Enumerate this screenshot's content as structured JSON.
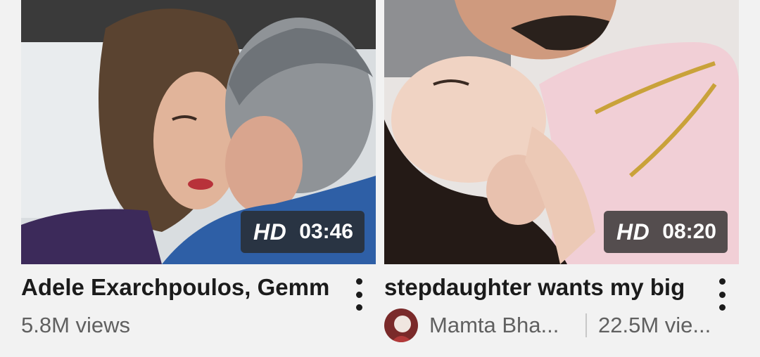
{
  "videos": [
    {
      "thumbnail": "scene-thumbnail",
      "quality": "HD",
      "duration": "03:46",
      "title": "Adele Exarchpoulos, Gemm",
      "views": "5.8M views",
      "menu_icon": "more-vertical-icon"
    },
    {
      "thumbnail": "scene-thumbnail",
      "quality": "HD",
      "duration": "08:20",
      "title": "stepdaughter wants my big",
      "channel": "Mamta Bha...",
      "views": "22.5M vie...",
      "avatar": "channel-avatar",
      "menu_icon": "more-vertical-icon"
    }
  ],
  "colors": {
    "background": "#f2f2f2",
    "title_text": "#1b1b1b",
    "meta_text": "#606060",
    "badge_bg": "rgba(40,40,40,0.78)"
  }
}
